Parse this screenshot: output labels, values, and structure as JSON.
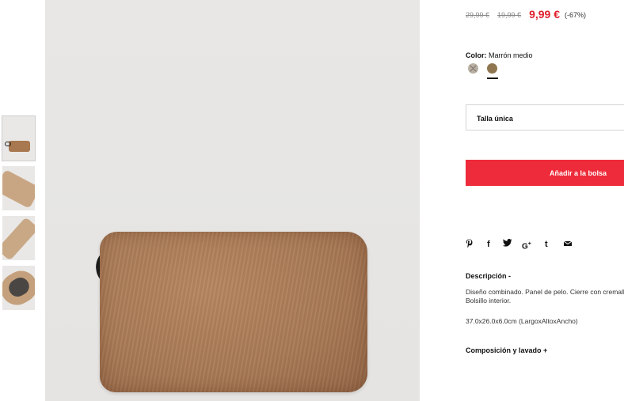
{
  "thumbnails": [
    {
      "alt": "bag-front",
      "active": true
    },
    {
      "alt": "bag-angle",
      "active": false
    },
    {
      "alt": "bag-side",
      "active": false
    },
    {
      "alt": "bag-inside",
      "active": false
    }
  ],
  "product_image": {
    "semantic": "faux-fur-clutch-photo"
  },
  "prices": {
    "original": "29,99 €",
    "previous": "19,99 €",
    "current": "9,99 €",
    "discount": "(-67%)"
  },
  "color": {
    "label": "Color:",
    "selected": "Marrón medio",
    "swatches": [
      {
        "name": "beige",
        "available": false,
        "hex": "#b9b0a3"
      },
      {
        "name": "Marrón medio",
        "available": true,
        "hex": "#8f7650"
      }
    ]
  },
  "size": {
    "label": "Talla única"
  },
  "cart": {
    "button_label": "Añadir a la bolsa",
    "accent": "#ee2b3a"
  },
  "share": {
    "icons": [
      {
        "name": "pinterest-icon",
        "glyph": "𝓅"
      },
      {
        "name": "facebook-icon",
        "glyph": "f"
      },
      {
        "name": "twitter-icon",
        "glyph": "🐦"
      },
      {
        "name": "googleplus-icon",
        "glyph": "G+"
      },
      {
        "name": "tumblr-icon",
        "glyph": "t"
      },
      {
        "name": "email-icon",
        "glyph": "✉"
      }
    ]
  },
  "description": {
    "title": "Descripción -",
    "line1": "Diseño combinado. Panel de pelo. Cierre con cremallera.",
    "line2": "Bolsillo interior.",
    "dimensions": "37.0x26.0x6.0cm (LargoxAltoxAncho)"
  },
  "composition": {
    "title": "Composición y lavado +"
  }
}
